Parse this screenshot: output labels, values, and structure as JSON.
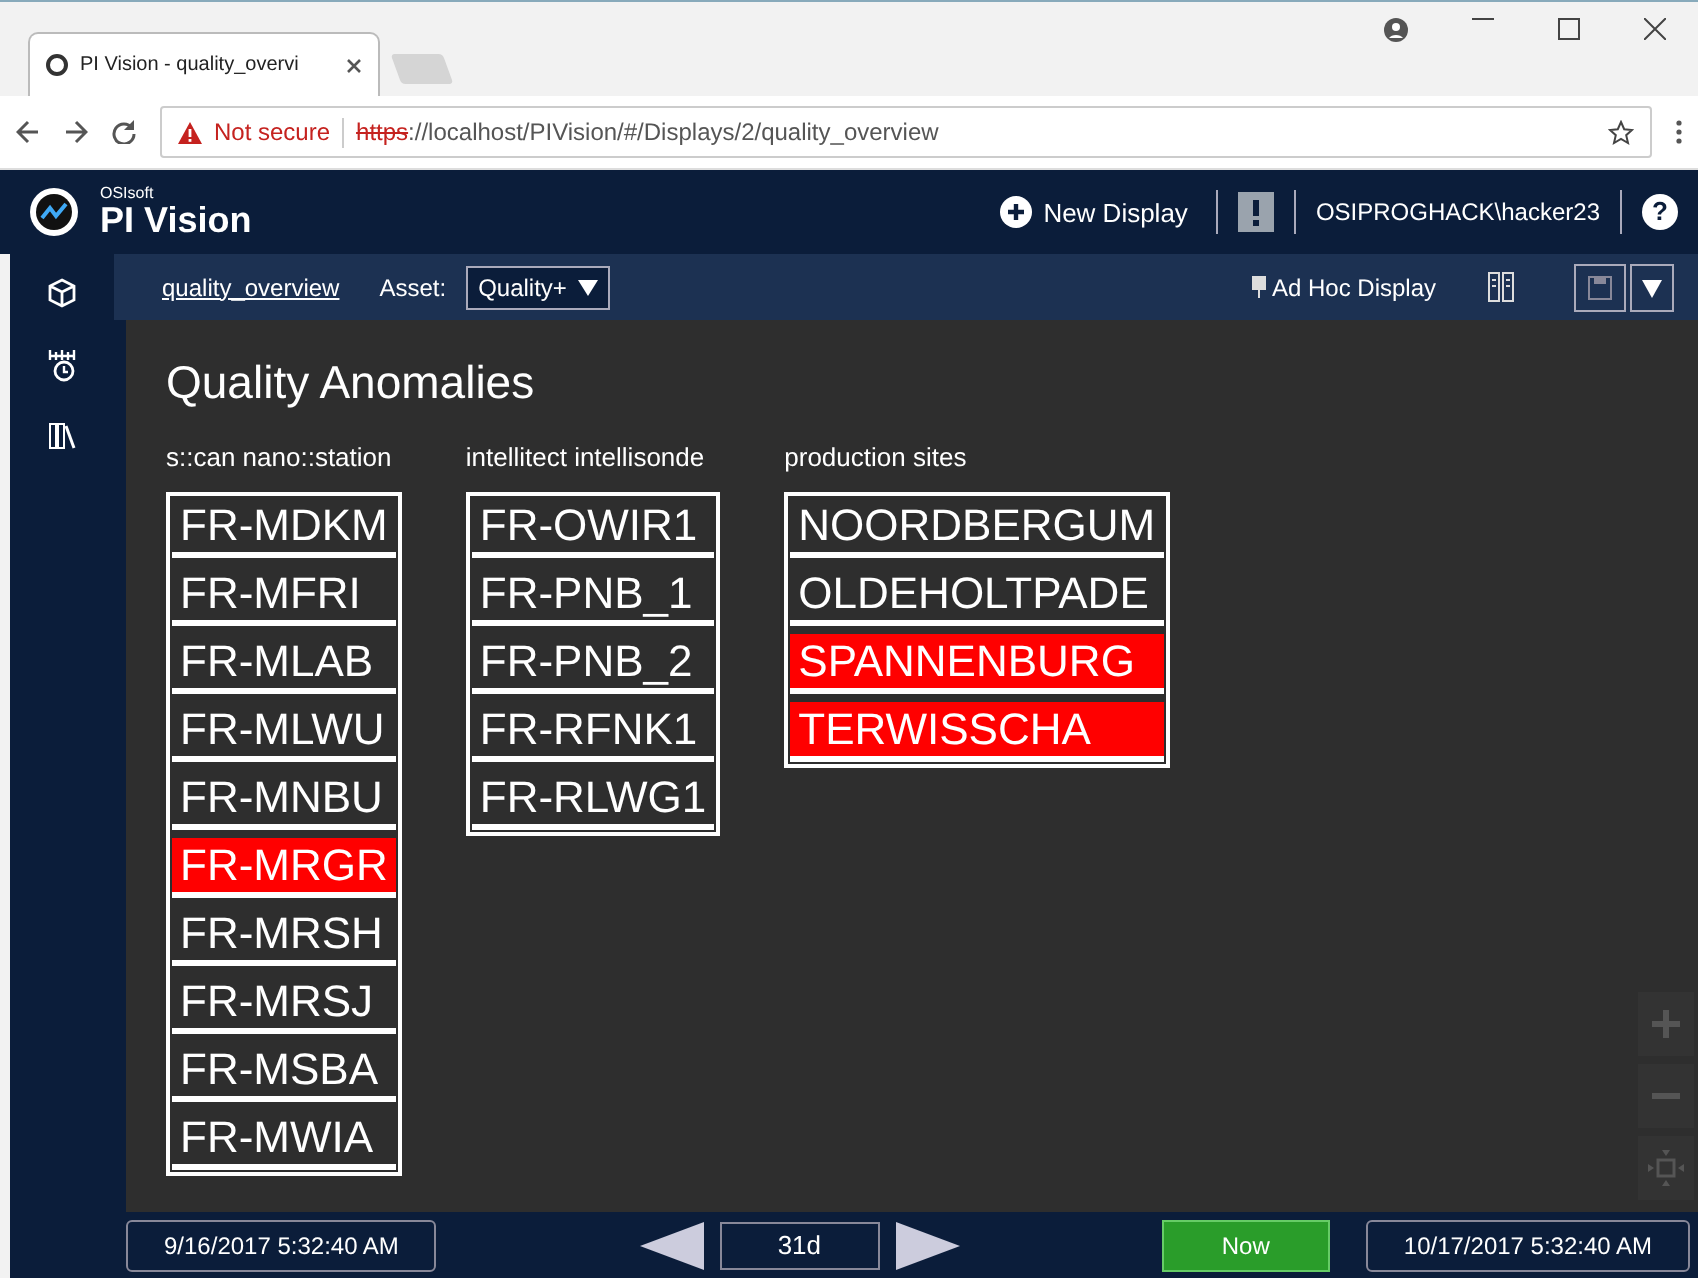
{
  "browser": {
    "tab_title": "PI Vision - quality_overvi",
    "security": "Not secure",
    "url_scheme": "https",
    "url_rest": "://localhost/PIVision/#/Displays/2/quality_overview"
  },
  "app": {
    "brand_small": "OSIsoft",
    "brand": "PI Vision",
    "new_display": "New Display",
    "user": "OSIPROGHACK\\hacker23",
    "help": "?"
  },
  "toolbar": {
    "display_link": "quality_overview",
    "asset_label": "Asset:",
    "asset_value": "Quality+",
    "adhoc": "Ad Hoc Display"
  },
  "display": {
    "title": "Quality Anomalies",
    "groups": [
      {
        "heading": "s::can nano::station",
        "items": [
          {
            "label": "FR-MDKM",
            "alarm": false
          },
          {
            "label": "FR-MFRI",
            "alarm": false
          },
          {
            "label": "FR-MLAB",
            "alarm": false
          },
          {
            "label": "FR-MLWU",
            "alarm": false
          },
          {
            "label": "FR-MNBU",
            "alarm": false
          },
          {
            "label": "FR-MRGR",
            "alarm": true
          },
          {
            "label": "FR-MRSH",
            "alarm": false
          },
          {
            "label": "FR-MRSJ",
            "alarm": false
          },
          {
            "label": "FR-MSBA",
            "alarm": false
          },
          {
            "label": "FR-MWIA",
            "alarm": false
          }
        ]
      },
      {
        "heading": "intellitect intellisonde",
        "items": [
          {
            "label": "FR-OWIR1",
            "alarm": false
          },
          {
            "label": "FR-PNB_1",
            "alarm": false
          },
          {
            "label": "FR-PNB_2",
            "alarm": false
          },
          {
            "label": "FR-RFNK1",
            "alarm": false
          },
          {
            "label": "FR-RLWG1",
            "alarm": false
          }
        ]
      },
      {
        "heading": "production sites",
        "items": [
          {
            "label": "NOORDBERGUM",
            "alarm": false
          },
          {
            "label": "OLDEHOLTPADE",
            "alarm": false
          },
          {
            "label": "SPANNENBURG",
            "alarm": true
          },
          {
            "label": "TERWISSCHA",
            "alarm": true
          }
        ]
      }
    ]
  },
  "timebar": {
    "start": "9/16/2017 5:32:40 AM",
    "duration": "31d",
    "now": "Now",
    "end": "10/17/2017 5:32:40 AM"
  }
}
